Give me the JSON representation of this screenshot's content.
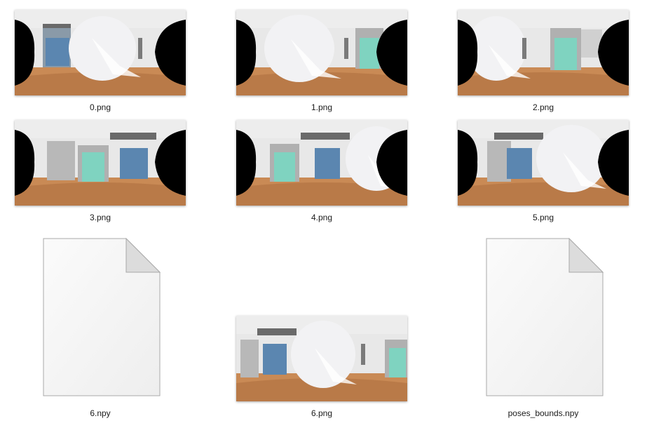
{
  "files": [
    {
      "name": "0.png",
      "type": "image",
      "view": 0
    },
    {
      "name": "1.png",
      "type": "image",
      "view": 1
    },
    {
      "name": "2.png",
      "type": "image",
      "view": 2
    },
    {
      "name": "3.png",
      "type": "image",
      "view": 3
    },
    {
      "name": "4.png",
      "type": "image",
      "view": 4
    },
    {
      "name": "5.png",
      "type": "image",
      "view": 5
    },
    {
      "name": "6.npy",
      "type": "generic-file",
      "icon": "blank-document-icon"
    },
    {
      "name": "6.png",
      "type": "image",
      "view": 6
    },
    {
      "name": "poses_bounds.npy",
      "type": "generic-file",
      "icon": "blank-document-icon"
    }
  ],
  "colors": {
    "background": "#ffffff",
    "label_text": "#1a1a1a",
    "floor": "#c98a55",
    "wall": "#dcdcdc",
    "glass_door": "#7fd3c0",
    "window_blue": "#5b86b0",
    "mask": "#000000"
  }
}
